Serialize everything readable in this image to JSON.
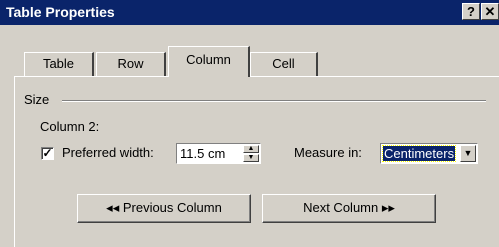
{
  "window": {
    "title": "Table Properties",
    "help_label": "?",
    "close_label": "✕"
  },
  "tabs": [
    {
      "label": "Table"
    },
    {
      "label": "Row"
    },
    {
      "label": "Column"
    },
    {
      "label": "Cell"
    }
  ],
  "size_group": {
    "label": "Size"
  },
  "column_label": "Column 2:",
  "preferred_width": {
    "checked_glyph": "✓",
    "label": "Preferred width:",
    "value": "11.5 cm"
  },
  "measure_in": {
    "label": "Measure in:",
    "selected": "Centimeters"
  },
  "buttons": {
    "previous": "◂◂ Previous Column",
    "next": "Next Column ▸▸"
  }
}
